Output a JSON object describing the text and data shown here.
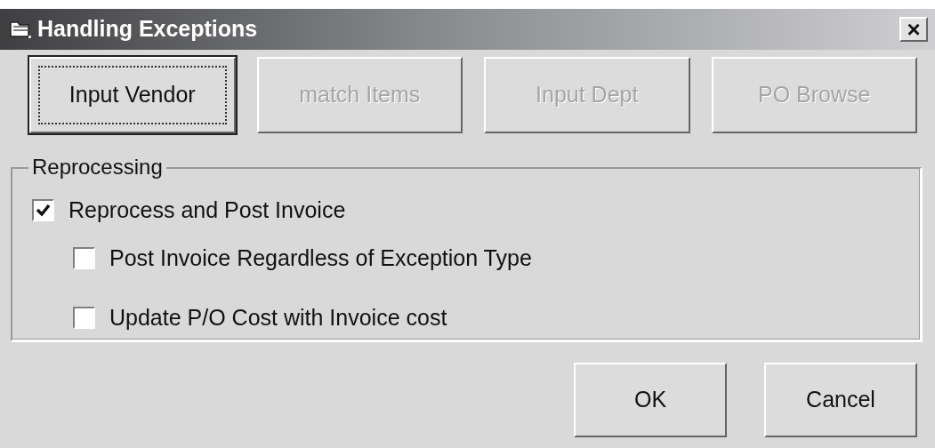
{
  "window": {
    "title": "Handling Exceptions",
    "close": "×"
  },
  "toolbar": [
    {
      "label": "Input Vendor",
      "disabled": false,
      "focused": true
    },
    {
      "label": "match Items",
      "disabled": true,
      "focused": false
    },
    {
      "label": "Input Dept",
      "disabled": true,
      "focused": false
    },
    {
      "label": "PO Browse",
      "disabled": true,
      "focused": false
    }
  ],
  "group": {
    "title": "Reprocessing",
    "options": [
      {
        "label": "Reprocess and Post Invoice",
        "checked": true,
        "children": [
          {
            "label": "Post Invoice Regardless of Exception Type",
            "checked": false
          },
          {
            "label": "Update P/O Cost with Invoice cost",
            "checked": false
          }
        ]
      }
    ]
  },
  "buttons": [
    {
      "label": "OK"
    },
    {
      "label": "Cancel"
    }
  ]
}
